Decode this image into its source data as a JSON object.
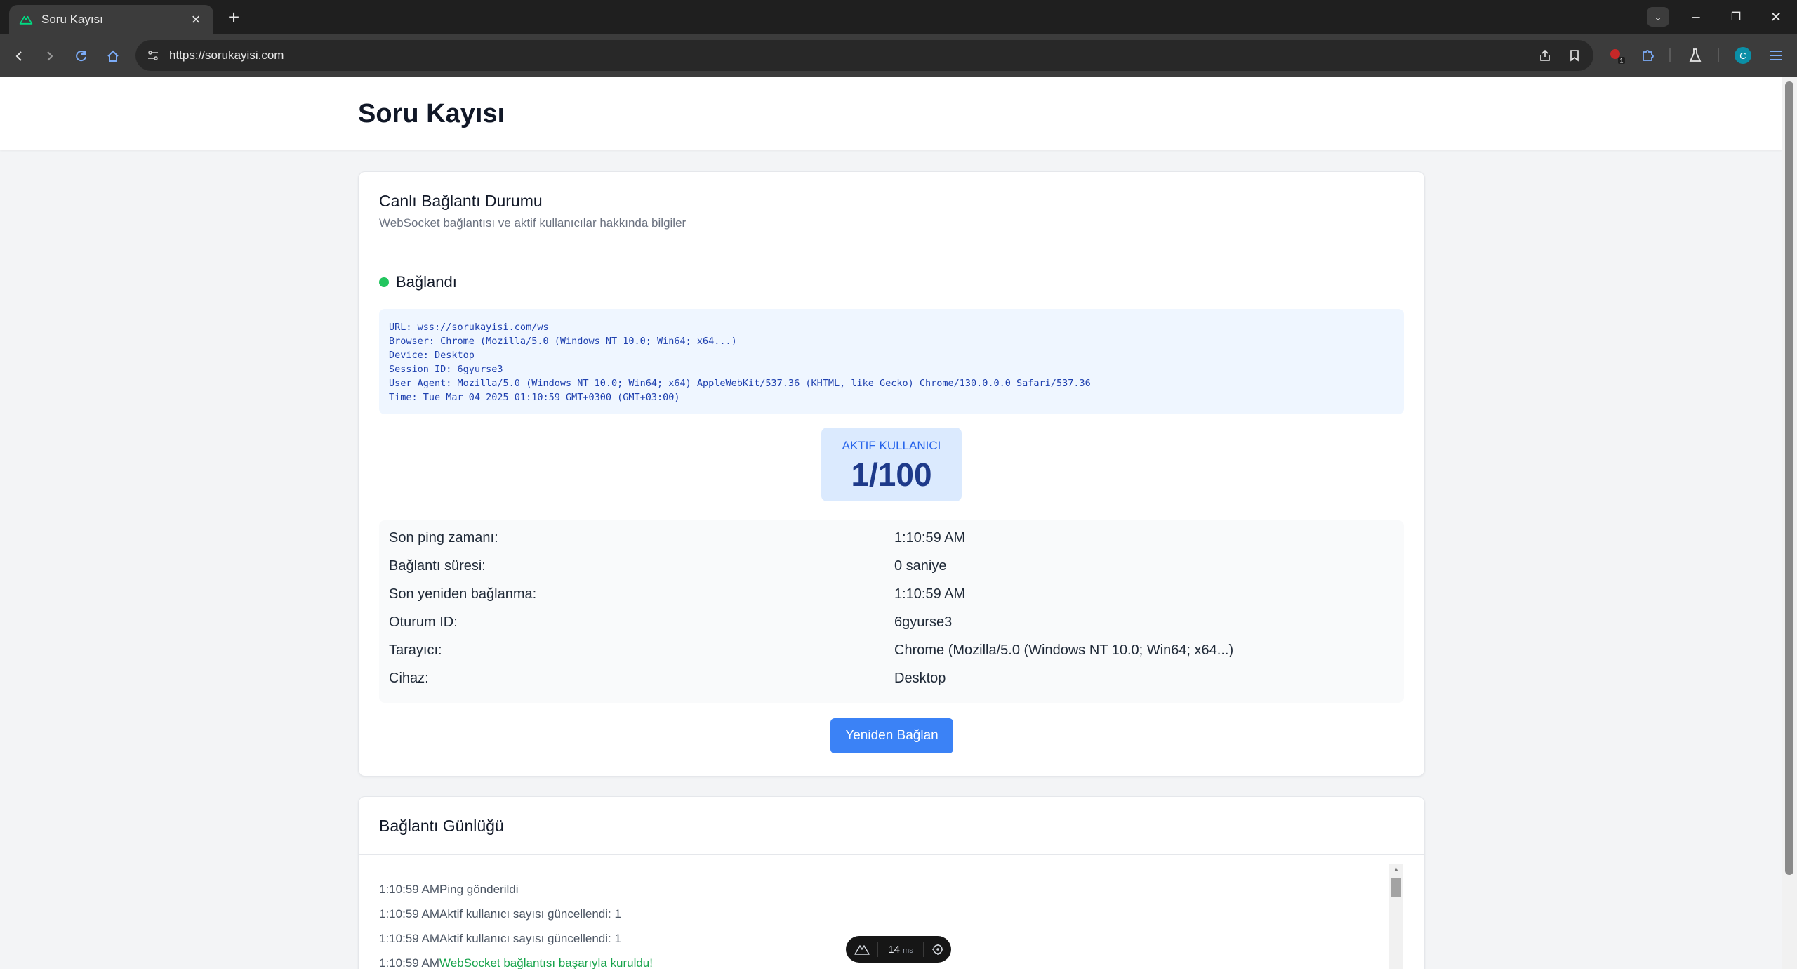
{
  "browser": {
    "tab_title": "Soru Kayısı",
    "url": "https://sorukayisi.com",
    "extension_badge": "1",
    "profile_initial": "C"
  },
  "page": {
    "title": "Soru Kayısı"
  },
  "connection_card": {
    "title": "Canlı Bağlantı Durumu",
    "subtitle": "WebSocket bağlantısı ve aktif kullanıcılar hakkında bilgiler",
    "status": "Bağlandı",
    "status_color": "#22c55e",
    "info_lines": [
      "URL: wss://sorukayisi.com/ws",
      "Browser: Chrome (Mozilla/5.0 (Windows NT 10.0; Win64; x64...)",
      "Device: Desktop",
      "Session ID: 6gyurse3",
      "User Agent: Mozilla/5.0 (Windows NT 10.0; Win64; x64) AppleWebKit/537.36 (KHTML, like Gecko) Chrome/130.0.0.0 Safari/537.36",
      "Time: Tue Mar 04 2025 01:10:59 GMT+0300 (GMT+03:00)"
    ],
    "active_users_label": "AKTIF KULLANICI",
    "active_users_value": "1/100",
    "stats": [
      {
        "label": "Son ping zamanı:",
        "value": "1:10:59 AM"
      },
      {
        "label": "Bağlantı süresi:",
        "value": "0 saniye"
      },
      {
        "label": "Son yeniden bağlanma:",
        "value": "1:10:59 AM"
      },
      {
        "label": "Oturum ID:",
        "value": "6gyurse3"
      },
      {
        "label": "Tarayıcı:",
        "value": "Chrome (Mozilla/5.0 (Windows NT 10.0; Win64; x64...)"
      },
      {
        "label": "Cihaz:",
        "value": "Desktop"
      }
    ],
    "reconnect_label": "Yeniden Bağlan",
    "accent_color": "#3b82f6"
  },
  "log_card": {
    "title": "Bağlantı Günlüğü",
    "entries": [
      {
        "time": "1:10:59 AM",
        "message": "Ping gönderildi",
        "success": false
      },
      {
        "time": "1:10:59 AM",
        "message": "Aktif kullanıcı sayısı güncellendi: 1",
        "success": false
      },
      {
        "time": "1:10:59 AM",
        "message": "Aktif kullanıcı sayısı güncellendi: 1",
        "success": false
      },
      {
        "time": "1:10:59 AM",
        "message": "WebSocket bağlantısı başarıyla kuruldu!",
        "success": true
      }
    ]
  },
  "devtools_pill": {
    "value": "14",
    "unit": "ms"
  }
}
